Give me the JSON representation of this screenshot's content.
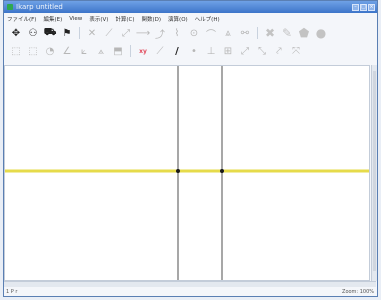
{
  "window": {
    "title": "Ikarp untitled"
  },
  "menubar": [
    "ファイル(F)",
    "編集(E)",
    "View",
    "表示(V)",
    "計算(C)",
    "関数(D)",
    "演算(O)",
    "ヘルプ(H)"
  ],
  "toolbar_rows": [
    [
      {
        "glyph": "✥",
        "name": "move-icon",
        "cls": "dark"
      },
      {
        "glyph": "⚇",
        "name": "point-icon",
        "cls": "dark"
      },
      {
        "glyph": "⛟",
        "name": "select-icon",
        "cls": "dark"
      },
      {
        "glyph": "⚑",
        "name": "pin-icon",
        "cls": "dark"
      },
      {
        "sep": true
      },
      {
        "glyph": "✕",
        "name": "intersection-icon",
        "cls": "faint"
      },
      {
        "glyph": "⟋",
        "name": "line-icon",
        "cls": "faint"
      },
      {
        "glyph": "⤢",
        "name": "ray-icon",
        "cls": "faint"
      },
      {
        "glyph": "⟶",
        "name": "vector-icon",
        "cls": "faint"
      },
      {
        "glyph": "⤴",
        "name": "parallel-icon",
        "cls": "faint"
      },
      {
        "glyph": "⌇",
        "name": "perpendicular-icon",
        "cls": "faint"
      },
      {
        "glyph": "⊙",
        "name": "circle-icon",
        "cls": "faint"
      },
      {
        "glyph": "⌒",
        "name": "arc-icon",
        "cls": "faint"
      },
      {
        "glyph": "⩓",
        "name": "polygon-icon",
        "cls": "faint"
      },
      {
        "glyph": "⚯",
        "name": "locus-icon",
        "cls": "faint"
      },
      {
        "sep": true
      },
      {
        "glyph": "✖",
        "name": "delete-icon",
        "cls": "blob"
      },
      {
        "glyph": "✎",
        "name": "pen-icon",
        "cls": "blob"
      },
      {
        "glyph": "⬟",
        "name": "fill-icon",
        "cls": "blob"
      },
      {
        "glyph": "●",
        "name": "color-icon",
        "cls": "blob"
      }
    ],
    [
      {
        "glyph": "⬚",
        "name": "rect-icon",
        "cls": "faint"
      },
      {
        "glyph": "⬚",
        "name": "frame-icon",
        "cls": "faint"
      },
      {
        "glyph": "◔",
        "name": "sector-icon",
        "cls": "faint"
      },
      {
        "glyph": "∠",
        "name": "angle-icon",
        "cls": "faint"
      },
      {
        "glyph": "⟀",
        "name": "measure-icon",
        "cls": "faint"
      },
      {
        "glyph": "⟑",
        "name": "transform-icon",
        "cls": "faint"
      },
      {
        "glyph": "⬒",
        "name": "box-icon",
        "cls": "faint"
      },
      {
        "sep": true
      },
      {
        "glyph": "xy",
        "name": "coordinates-icon",
        "cls": "red"
      },
      {
        "glyph": "⟋",
        "name": "slope-icon",
        "cls": "faint"
      },
      {
        "glyph": "/",
        "name": "graph-line-icon",
        "cls": "dark"
      },
      {
        "glyph": "•",
        "name": "dot-icon",
        "cls": "faint"
      },
      {
        "glyph": "⊥",
        "name": "axis-icon",
        "cls": "faint"
      },
      {
        "glyph": "⊞",
        "name": "grid-icon",
        "cls": "faint"
      },
      {
        "glyph": "⤢",
        "name": "curve-icon",
        "cls": "faint"
      },
      {
        "glyph": "⤡",
        "name": "scale-icon",
        "cls": "faint"
      },
      {
        "glyph": "⤤",
        "name": "trend-icon",
        "cls": "faint"
      },
      {
        "glyph": "⤧",
        "name": "plot-icon",
        "cls": "faint"
      }
    ]
  ],
  "status": {
    "left": "1 P r",
    "right": "Zoom: 100%"
  },
  "colors": {
    "horizontal_line": "#e6db4a",
    "vertical_line": "#a7a7a7",
    "point": "#1b1b1b"
  }
}
